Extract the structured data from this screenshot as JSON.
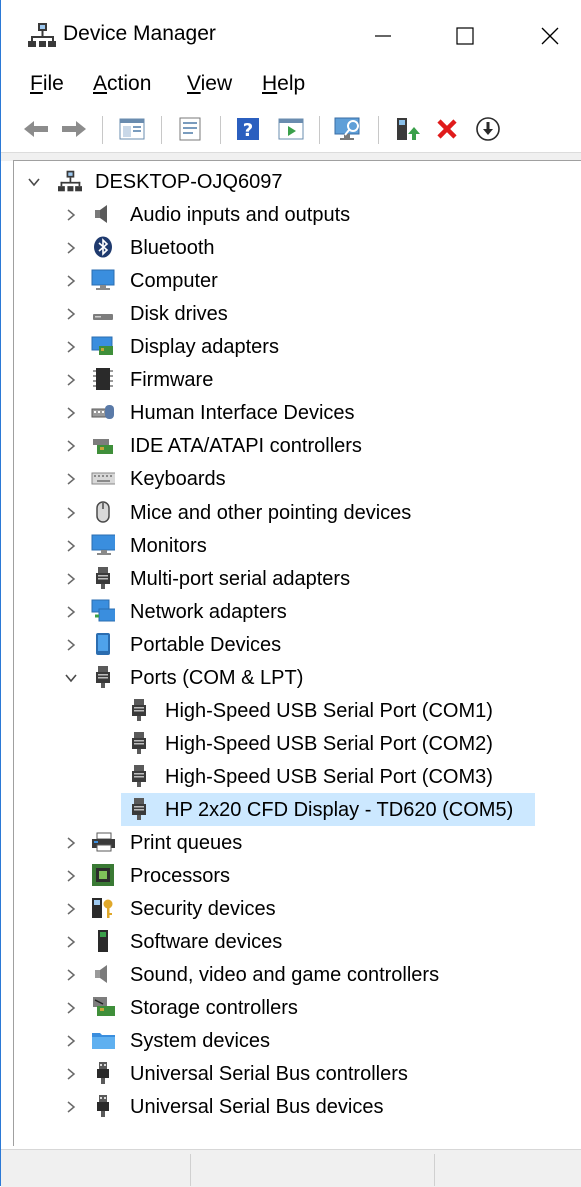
{
  "window": {
    "title": "Device Manager"
  },
  "menu": [
    {
      "accel": "F",
      "rest": "ile"
    },
    {
      "accel": "A",
      "rest": "ction"
    },
    {
      "accel": "V",
      "rest": "iew"
    },
    {
      "accel": "H",
      "rest": "elp"
    }
  ],
  "toolbar": [
    "back-arrow-icon",
    "forward-arrow-icon",
    "show-hide-tree-icon",
    "properties-icon",
    "help-icon",
    "run-icon",
    "scan-hardware-icon",
    "update-driver-icon",
    "uninstall-icon",
    "disable-icon"
  ],
  "tree": {
    "root": "DESKTOP-OJQ6097",
    "categories": [
      {
        "label": "Audio inputs and outputs",
        "icon": "speaker-icon"
      },
      {
        "label": "Bluetooth",
        "icon": "bluetooth-icon"
      },
      {
        "label": "Computer",
        "icon": "computer-icon"
      },
      {
        "label": "Disk drives",
        "icon": "disk-drive-icon"
      },
      {
        "label": "Display adapters",
        "icon": "display-adapter-icon"
      },
      {
        "label": "Firmware",
        "icon": "firmware-icon"
      },
      {
        "label": "Human Interface Devices",
        "icon": "hid-icon"
      },
      {
        "label": "IDE ATA/ATAPI controllers",
        "icon": "ide-controller-icon"
      },
      {
        "label": "Keyboards",
        "icon": "keyboard-icon"
      },
      {
        "label": "Mice and other pointing devices",
        "icon": "mouse-icon"
      },
      {
        "label": "Monitors",
        "icon": "monitor-icon"
      },
      {
        "label": "Multi-port serial adapters",
        "icon": "serial-plug-icon"
      },
      {
        "label": "Network adapters",
        "icon": "network-icon"
      },
      {
        "label": "Portable Devices",
        "icon": "portable-device-icon"
      },
      {
        "label": "Ports (COM & LPT)",
        "icon": "port-icon",
        "expanded": true,
        "children": [
          "High-Speed USB Serial Port (COM1)",
          "High-Speed USB Serial Port (COM2)",
          "High-Speed USB Serial Port (COM3)",
          "HP 2x20 CFD Display - TD620 (COM5)"
        ],
        "selected_child": 3
      },
      {
        "label": "Print queues",
        "icon": "printer-icon"
      },
      {
        "label": "Processors",
        "icon": "processor-icon"
      },
      {
        "label": "Security devices",
        "icon": "security-key-icon"
      },
      {
        "label": "Software devices",
        "icon": "software-device-icon"
      },
      {
        "label": "Sound, video and game controllers",
        "icon": "sound-icon"
      },
      {
        "label": "Storage controllers",
        "icon": "storage-controller-icon"
      },
      {
        "label": "System devices",
        "icon": "system-folder-icon"
      },
      {
        "label": "Universal Serial Bus controllers",
        "icon": "usb-icon"
      },
      {
        "label": "Universal Serial Bus devices",
        "icon": "usb-icon"
      }
    ]
  },
  "colors": {
    "selection": "#cce8ff",
    "accent": "#2b79d6"
  }
}
